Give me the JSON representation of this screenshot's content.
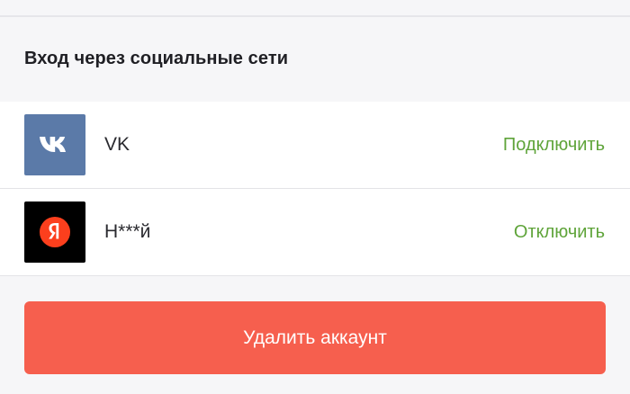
{
  "social": {
    "title": "Вход через социальные сети",
    "accounts": [
      {
        "name": "VK",
        "action": "Подключить",
        "icon": "vk-icon",
        "color": "#5b7aa8"
      },
      {
        "name": "Н***й",
        "action": "Отключить",
        "icon": "yandex-icon",
        "color": "#000000",
        "accent": "#fc3f1d"
      }
    ]
  },
  "delete_account": {
    "label": "Удалить аккаунт",
    "color": "#f65f4e"
  },
  "colors": {
    "action_link": "#5fa43a",
    "background": "#f6f6f8"
  }
}
